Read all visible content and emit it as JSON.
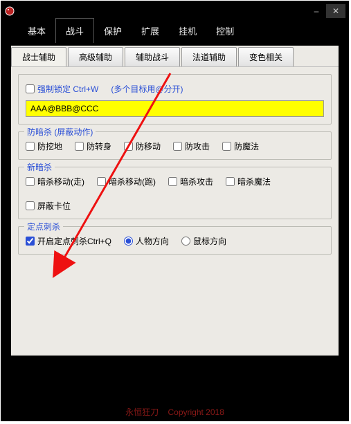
{
  "titlebar": {
    "minimize": "–",
    "close": "✕"
  },
  "main_tabs": {
    "tabs": [
      "基本",
      "战斗",
      "保护",
      "扩展",
      "挂机",
      "控制"
    ],
    "active": 1
  },
  "sub_tabs": {
    "tabs": [
      "战士辅助",
      "高级辅助",
      "辅助战斗",
      "法道辅助",
      "变色相关"
    ],
    "active": 0
  },
  "group_lock": {
    "cb_label": "强制锁定 Ctrl+W",
    "hint": "(多个目标用@分开)",
    "input_value": "AAA@BBB@CCC"
  },
  "group_prevent": {
    "legend": "防暗杀 (屏蔽动作)",
    "items": [
      "防挖地",
      "防转身",
      "防移动",
      "防攻击",
      "防魔法"
    ]
  },
  "group_assassin": {
    "legend": "新暗杀",
    "items": [
      "暗杀移动(走)",
      "暗杀移动(跑)",
      "暗杀攻击",
      "暗杀魔法",
      "屏蔽卡位"
    ]
  },
  "group_fixed": {
    "legend": "定点刺杀",
    "cb_label": "开启定点刺杀Ctrl+Q",
    "radios": [
      "人物方向",
      "鼠标方向"
    ]
  },
  "footer": {
    "brand": "永恒狂刀",
    "copyright": "Copyright 2018"
  }
}
